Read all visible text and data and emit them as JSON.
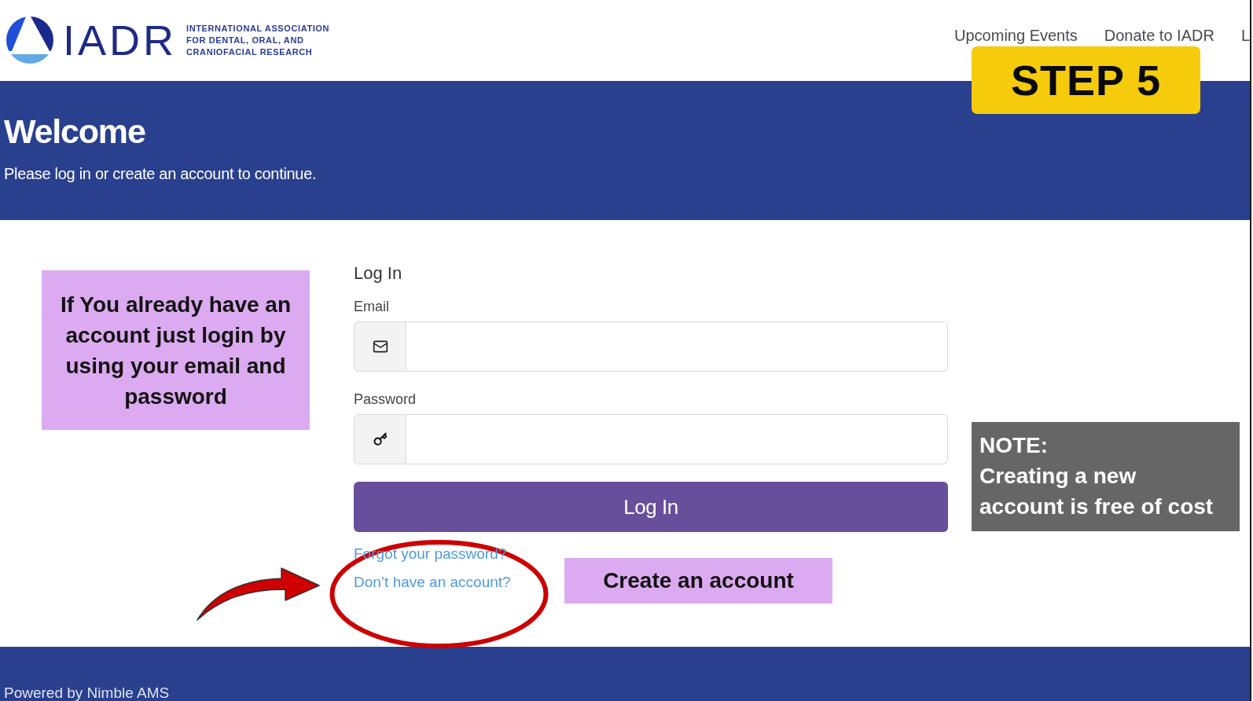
{
  "header": {
    "logo": {
      "wordmark": "IADR",
      "tagline_lines": [
        "INTERNATIONAL ASSOCIATION",
        "FOR DENTAL, ORAL, AND",
        "CRANIOFACIAL RESEARCH"
      ]
    },
    "nav": [
      "Upcoming Events",
      "Donate to IADR",
      "L"
    ]
  },
  "step_label": "STEP 5",
  "banner": {
    "title": "Welcome",
    "subtitle": "Please log in or create an account to continue."
  },
  "login_tip": "If You already have an account just login by using your email and password",
  "login_form": {
    "heading": "Log In",
    "fields": [
      {
        "kind": "email",
        "label": "Email"
      },
      {
        "kind": "password",
        "label": "Password"
      }
    ],
    "submit": "Log In",
    "links": [
      "Forgot your password?",
      "Don’t have an account?"
    ]
  },
  "create_account_tip": "Create an account",
  "note": {
    "title": "NOTE:",
    "text": "Creating a new account is free of cost"
  },
  "footer": {
    "text": "Powered by Nimble AMS"
  }
}
